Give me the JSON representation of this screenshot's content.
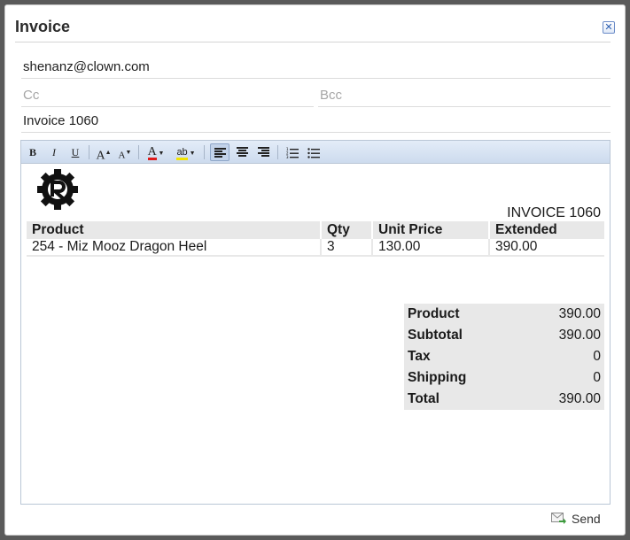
{
  "dialog": {
    "title": "Invoice",
    "close_symbol": "✕"
  },
  "email": {
    "to_value": "shenanz@clown.com",
    "cc_placeholder": "Cc",
    "bcc_placeholder": "Bcc",
    "subject_value": "Invoice 1060"
  },
  "toolbar": {
    "bold": "B",
    "italic": "I",
    "underline": "U",
    "grow": "A",
    "shrink": "A",
    "font_color": "A",
    "highlight": "ab",
    "icons": [
      "bold-icon",
      "italic-icon",
      "underline-icon",
      "font-grow-icon",
      "font-shrink-icon",
      "font-color-icon",
      "highlight-icon",
      "align-left-icon",
      "align-center-icon",
      "align-right-icon",
      "ordered-list-icon",
      "unordered-list-icon"
    ],
    "font_color_hex": "#e01b1b",
    "highlight_hex": "#f2e400"
  },
  "invoice": {
    "heading": "INVOICE 1060",
    "columns": [
      "Product",
      "Qty",
      "Unit Price",
      "Extended"
    ],
    "rows": [
      [
        "254 - Miz Mooz Dragon Heel",
        "3",
        "130.00",
        "390.00"
      ]
    ],
    "totals": [
      {
        "label": "Product",
        "value": "390.00"
      },
      {
        "label": "Subtotal",
        "value": "390.00"
      },
      {
        "label": "Tax",
        "value": "0"
      },
      {
        "label": "Shipping",
        "value": "0"
      },
      {
        "label": "Total",
        "value": "390.00"
      }
    ]
  },
  "footer": {
    "send_label": "Send",
    "send_icon": "envelope-send-icon"
  }
}
